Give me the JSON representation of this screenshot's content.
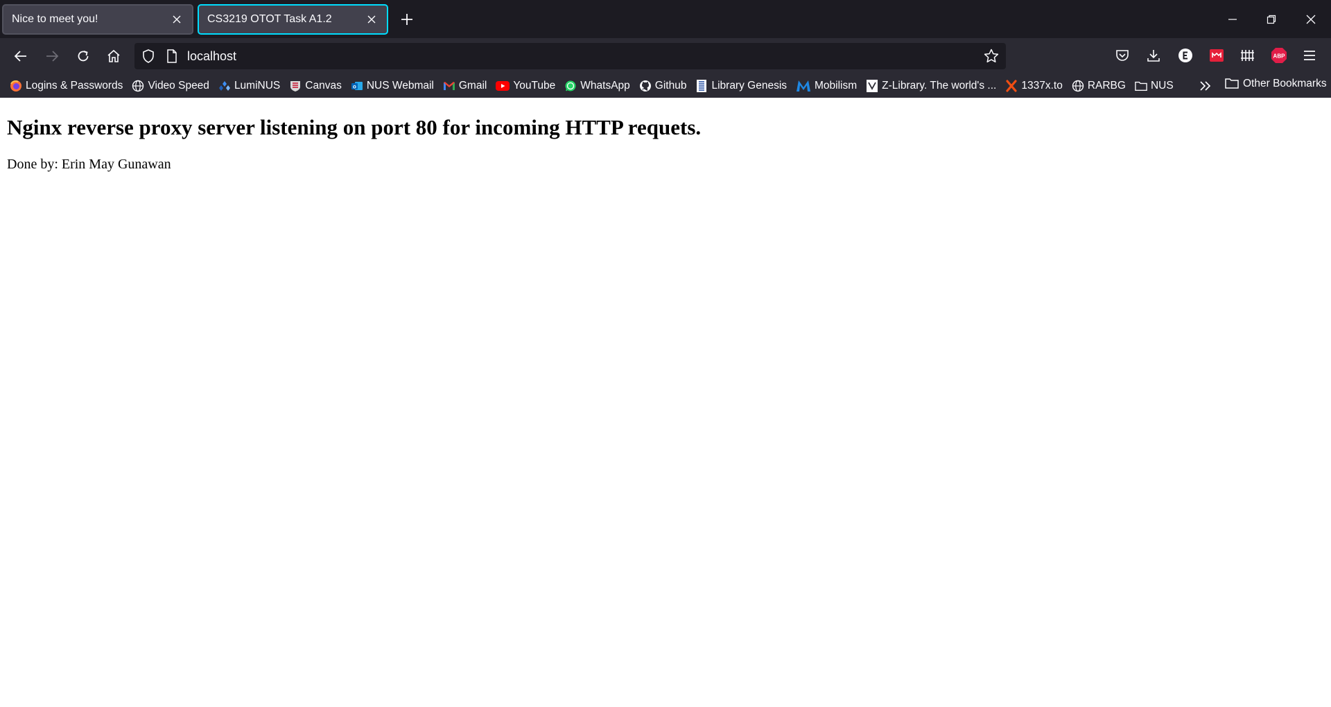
{
  "browser": {
    "tabs": [
      {
        "title": "Nice to meet you!",
        "active": false
      },
      {
        "title": "CS3219 OTOT Task A1.2",
        "active": true
      }
    ],
    "url": "localhost",
    "accent_color": "#00ddff"
  },
  "bookmarks": {
    "items": [
      {
        "label": "Logins & Passwords",
        "icon": "firefox-icon"
      },
      {
        "label": "Video Speed",
        "icon": "globe-icon"
      },
      {
        "label": "LumiNUS",
        "icon": "luminus-icon"
      },
      {
        "label": "Canvas",
        "icon": "canvas-icon"
      },
      {
        "label": "NUS Webmail",
        "icon": "outlook-icon"
      },
      {
        "label": "Gmail",
        "icon": "gmail-icon"
      },
      {
        "label": "YouTube",
        "icon": "youtube-icon"
      },
      {
        "label": "WhatsApp",
        "icon": "whatsapp-icon"
      },
      {
        "label": "Github",
        "icon": "github-icon"
      },
      {
        "label": "Library Genesis",
        "icon": "libgen-icon"
      },
      {
        "label": "Mobilism",
        "icon": "mobilism-icon"
      },
      {
        "label": "Z-Library. The world's ...",
        "icon": "zlibrary-icon"
      },
      {
        "label": "1337x.to",
        "icon": "1337x-icon"
      },
      {
        "label": "RARBG",
        "icon": "globe-icon"
      },
      {
        "label": "NUS",
        "icon": "folder-icon"
      }
    ],
    "other_label": "Other Bookmarks"
  },
  "page": {
    "heading": "Nginx reverse proxy server listening on port 80 for incoming HTTP requets.",
    "byline": "Done by: Erin May Gunawan"
  }
}
